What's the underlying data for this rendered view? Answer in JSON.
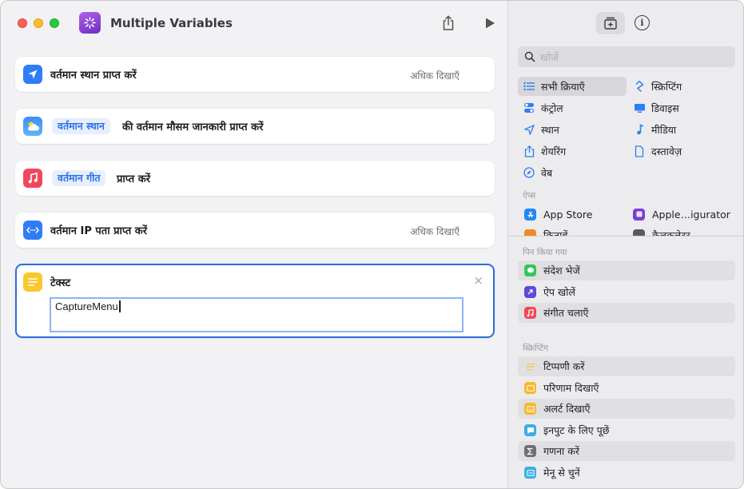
{
  "window": {
    "title": "Multiple Variables",
    "colors": {
      "accent": "#2d6fe0",
      "token_text": "#2c72e8",
      "token_bg": "#e8eefb"
    }
  },
  "toolbar": {
    "share_icon": "share-icon",
    "run_icon": "play-icon"
  },
  "editor": {
    "actions": [
      {
        "icon": "location-arrow-icon",
        "text": "वर्तमान स्थान प्राप्त करें",
        "more": "अधिक दिखाएँ"
      },
      {
        "icon": "weather-icon",
        "token": "वर्तमान स्थान",
        "text": "की वर्तमान मौसम जानकारी प्राप्त करें"
      },
      {
        "icon": "music-note-icon",
        "token": "वर्तमान गीत",
        "text": "प्राप्त करें"
      },
      {
        "icon": "network-icon",
        "text": "वर्तमान IP पता प्राप्त करें",
        "more": "अधिक दिखाएँ"
      }
    ],
    "text_action": {
      "title": "टेक्स्ट",
      "value": "CaptureMenu",
      "close": "×"
    }
  },
  "sidebar": {
    "tabs": {
      "library_icon": "action-library-icon",
      "info": "i"
    },
    "search": {
      "placeholder": "खोजें"
    },
    "categories": [
      {
        "label": "सभी क्रियाएँ",
        "icon": "list-icon",
        "active": true
      },
      {
        "label": "स्क्रिप्टिंग",
        "icon": "scripting-icon"
      },
      {
        "label": "कंट्रोल",
        "icon": "toggle-icon"
      },
      {
        "label": "डिवाइस",
        "icon": "display-icon"
      },
      {
        "label": "स्थान",
        "icon": "location-icon"
      },
      {
        "label": "मीडिया",
        "icon": "music-note-icon"
      },
      {
        "label": "शेयरिंग",
        "icon": "share-icon"
      },
      {
        "label": "दस्तावेज़",
        "icon": "document-icon"
      },
      {
        "label": "वेब",
        "icon": "compass-icon"
      }
    ],
    "apps_label": "ऐप्स",
    "apps": [
      {
        "label": "App Store",
        "icon": "app-store-icon",
        "color": "#1e88f5"
      },
      {
        "label": "Apple…igurator",
        "icon": "configurator-icon",
        "color": "#7b3fd6"
      },
      {
        "label": "किताबें",
        "icon": "books-icon",
        "color": "#f08a24"
      },
      {
        "label": "कैलकुलेटर",
        "icon": "calculator-icon",
        "color": "#5a5a5e"
      }
    ],
    "pinned_label": "पिन किया गया",
    "pinned": [
      {
        "label": "संदेश भेजें",
        "icon": "messages-icon",
        "color": "#34c759"
      },
      {
        "label": "ऐप खोलें",
        "icon": "open-app-icon",
        "color": "#5b4bd6"
      },
      {
        "label": "संगीत चलाएँ",
        "icon": "music-icon",
        "color": "#f0475a"
      }
    ],
    "scripting_label": "स्क्रिप्टिंग",
    "scripting": [
      {
        "label": "टिप्पणी करें",
        "icon": "comment-lines-icon",
        "color": "#f6c544"
      },
      {
        "label": "परिणाम दिखाएँ",
        "icon": "show-result-icon",
        "color": "#f6b82c"
      },
      {
        "label": "अलर्ट दिखाएँ",
        "icon": "alert-icon",
        "color": "#f6b82c"
      },
      {
        "label": "इनपुट के लिए पूछें",
        "icon": "ask-input-icon",
        "color": "#3aaee8"
      },
      {
        "label": "गणना करें",
        "icon": "sigma-icon",
        "color": "#6e6e73"
      },
      {
        "label": "मेनू से चुनें",
        "icon": "menu-icon",
        "color": "#3aaee8"
      }
    ]
  }
}
